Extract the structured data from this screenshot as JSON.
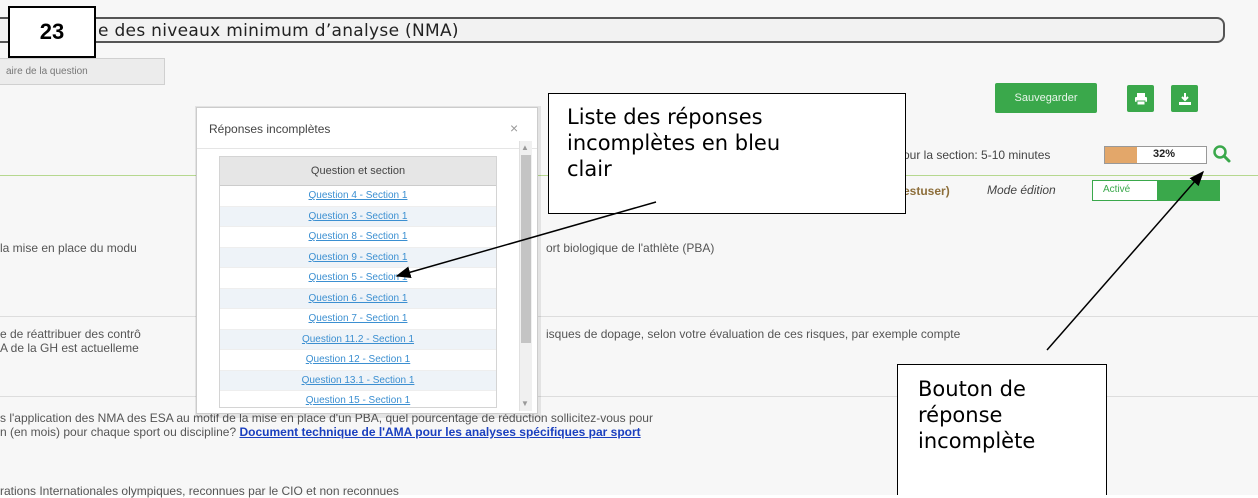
{
  "step_number": "23",
  "title": "e des niveaux minimum d’analyse (NMA)",
  "context_button": "aire de la question",
  "toolbar": {
    "save_label": "Sauvegarder",
    "print_icon": "print-icon",
    "download_icon": "download-icon"
  },
  "section_info": {
    "time_label": "our la section: 5-10 minutes",
    "progress_text": "32%",
    "progress_fraction": 0.32
  },
  "user_label": "estuser)",
  "mode": {
    "label": "Mode édition",
    "toggle_label": "Activé"
  },
  "background_text": {
    "line1a": "la mise en place du modu",
    "line1b": "ort biologique de l'athlète (PBA)",
    "line2a": "e de réattribuer des contrô",
    "line2b": "isques de dopage, selon votre évaluation de ces risques, par exemple compte",
    "line3a": "A de la GH est actuelleme",
    "line4": "s l'application des NMA des ESA au motif de la mise en place d'un PBA, quel pourcentage de réduction sollicitez-vous pour",
    "line5_text": "n (en mois) pour chaque sport ou discipline?",
    "line5_link": "Document technique de l'AMA pour les analyses spécifiques par sport",
    "line6": "rations Internationales olympiques, reconnues par le CIO et non reconnues"
  },
  "modal": {
    "title": "Réponses incomplètes",
    "close": "×",
    "column_header": "Question et section",
    "rows": [
      "Question 4 - Section 1",
      "Question 3 - Section 1",
      "Question 8 - Section 1",
      "Question 9 - Section 1",
      "Question 5 - Section 1",
      "Question 6 - Section 1",
      "Question 7 - Section 1",
      "Question 11.2 - Section 1",
      "Question 12 - Section 1",
      "Question 13.1 - Section 1",
      "Question 15 - Section 1"
    ]
  },
  "callouts": {
    "list_note_1": "Liste des réponses",
    "list_note_2": "incomplètes en bleu",
    "list_note_3": "clair",
    "button_note_1": "Bouton de",
    "button_note_2": "réponse",
    "button_note_3": "incomplète"
  }
}
